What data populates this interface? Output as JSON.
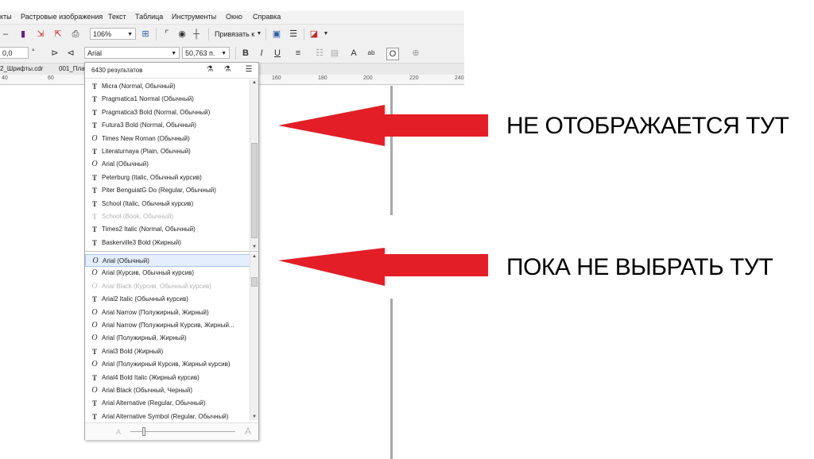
{
  "menu": [
    "кты",
    "Растровые изображения",
    "Текст",
    "Таблица",
    "Инструменты",
    "Окно",
    "Справка"
  ],
  "toolbar": {
    "zoom": "106%",
    "snap_label": "Привязать к"
  },
  "propbar": {
    "rotation": "0,0",
    "degree": "°",
    "font_name": "Arial",
    "font_size": "50,763 п."
  },
  "tabs": [
    "2_Шрифты.cdr",
    "001_Пла"
  ],
  "ruler": [
    "40",
    "60",
    "160",
    "180",
    "200",
    "220",
    "240"
  ],
  "dropdown": {
    "results_count": "6430 результатов",
    "recent_fonts": [
      {
        "name": "Micra (Normal, Обычный)",
        "icon": "truetype-icon"
      },
      {
        "name": "Pragmatica1 Normal (Обычный)",
        "icon": "truetype-icon"
      },
      {
        "name": "Pragmatica3 Bold (Normal, Обычный)",
        "icon": "truetype-icon"
      },
      {
        "name": "Futura3 Bold (Normal, Обычный)",
        "icon": "truetype-icon"
      },
      {
        "name": "Times New Roman (Обычный)",
        "icon": "opentype-icon"
      },
      {
        "name": "Literaturnaya (Plain, Обычный)",
        "icon": "truetype-icon"
      },
      {
        "name": "Arial (Обычный)",
        "icon": "opentype-icon"
      },
      {
        "name": "Peterburg (Italic, Обычный курсив)",
        "icon": "truetype-icon"
      },
      {
        "name": "Piter BenguiatG Do (Regular, Обычный)",
        "icon": "truetype-icon"
      },
      {
        "name": "School (Italic, Обычный курсив)",
        "icon": "truetype-icon"
      },
      {
        "name": "School (Book, Обычный)",
        "icon": "truetype-icon",
        "dimmed": true
      },
      {
        "name": "Times2 Italic (Normal, Обычный)",
        "icon": "truetype-icon"
      },
      {
        "name": "Baskerville3 Bold (Жирный)",
        "icon": "truetype-icon"
      }
    ],
    "all_fonts": [
      {
        "name": "Arial (Обычный)",
        "icon": "opentype-icon",
        "selected": true
      },
      {
        "name": "Arial (Курсив, Обычный курсив)",
        "icon": "opentype-icon"
      },
      {
        "name": "Arial Black (Курсив, Обычный курсив)",
        "icon": "opentype-icon",
        "dimmed": true
      },
      {
        "name": "Arial2 Italic (Обычный курсив)",
        "icon": "truetype-icon"
      },
      {
        "name": "Arial Narrow (Полужирный, Жирный)",
        "icon": "opentype-icon"
      },
      {
        "name": "Arial Narrow (Полужирный Курсив, Жирный...",
        "icon": "opentype-icon"
      },
      {
        "name": "Arial (Полужирный, Жирный)",
        "icon": "opentype-icon"
      },
      {
        "name": "Arial3 Bold (Жирный)",
        "icon": "truetype-icon"
      },
      {
        "name": "Arial (Полужирный Курсив, Жирный курсив)",
        "icon": "opentype-icon"
      },
      {
        "name": "Arial4 Bold Italic (Жирный курсив)",
        "icon": "truetype-icon"
      },
      {
        "name": "Arial Black (Обычный, Черный)",
        "icon": "opentype-icon"
      },
      {
        "name": "Arial Alternative (Regular, Обычный)",
        "icon": "truetype-icon"
      },
      {
        "name": "Arial Alternative Symbol (Regular, Обычный)",
        "icon": "truetype-icon"
      }
    ]
  },
  "annotations": {
    "top": "НЕ ОТОБРАЖАЕТСЯ ТУТ",
    "bottom": "ПОКА НЕ ВЫБРАТЬ ТУТ",
    "arrow_color": "#e41e26"
  }
}
